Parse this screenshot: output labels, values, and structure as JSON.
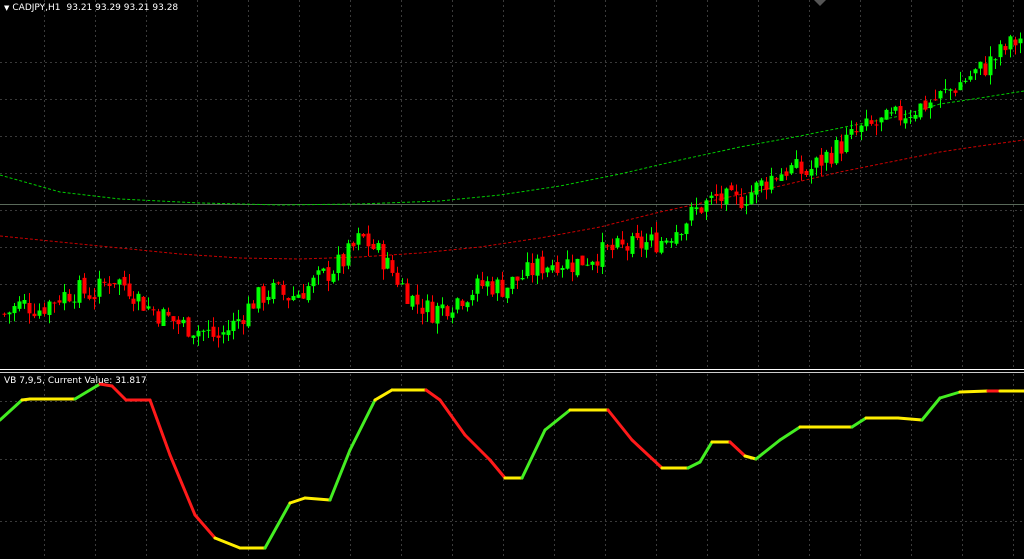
{
  "main_panel": {
    "arrow": "▼",
    "symbol": "CADJPY,H1",
    "prices": "93.21 93.29 93.21 93.28"
  },
  "indicator_panel": {
    "title": "VB 7,9,5, Current Value: 31.817"
  },
  "colors": {
    "background": "#000000",
    "grid": "#3a3a3a",
    "bull_candle": "#00ff00",
    "bear_candle": "#ff0000",
    "ma_green": "#00cc00",
    "ma_red": "#cc0000",
    "separator": "#ffffff",
    "osc_up": "#44ee22",
    "osc_down": "#ff1a1a",
    "osc_flat": "#ffee00"
  },
  "chart_data": {
    "type": "candlestick",
    "symbol": "CADJPY",
    "timeframe": "H1",
    "last_ohlc": [
      93.21,
      93.29,
      93.21,
      93.28
    ],
    "price_path": [
      0.42,
      0.5,
      0.46,
      0.55,
      0.6,
      0.57,
      0.7,
      0.62,
      0.48,
      0.4,
      0.34,
      0.3,
      0.24,
      0.36,
      0.52,
      0.6,
      0.55,
      0.62,
      0.72,
      0.82,
      1.0,
      0.88,
      0.7,
      0.52,
      0.44,
      0.5,
      0.58,
      0.65,
      0.62,
      0.7,
      0.78,
      0.82,
      0.8,
      0.86,
      0.9,
      0.92,
      0.95,
      0.98,
      1.1,
      1.22,
      1.3,
      1.26,
      1.35,
      1.45,
      1.52,
      1.48,
      1.6,
      1.7,
      1.8,
      1.85,
      1.9,
      1.96,
      2.02,
      2.1,
      2.2,
      2.28,
      2.4,
      2.5
    ],
    "oscillator": {
      "name": "VB 7,9,5",
      "current_value": 31.817
    }
  }
}
